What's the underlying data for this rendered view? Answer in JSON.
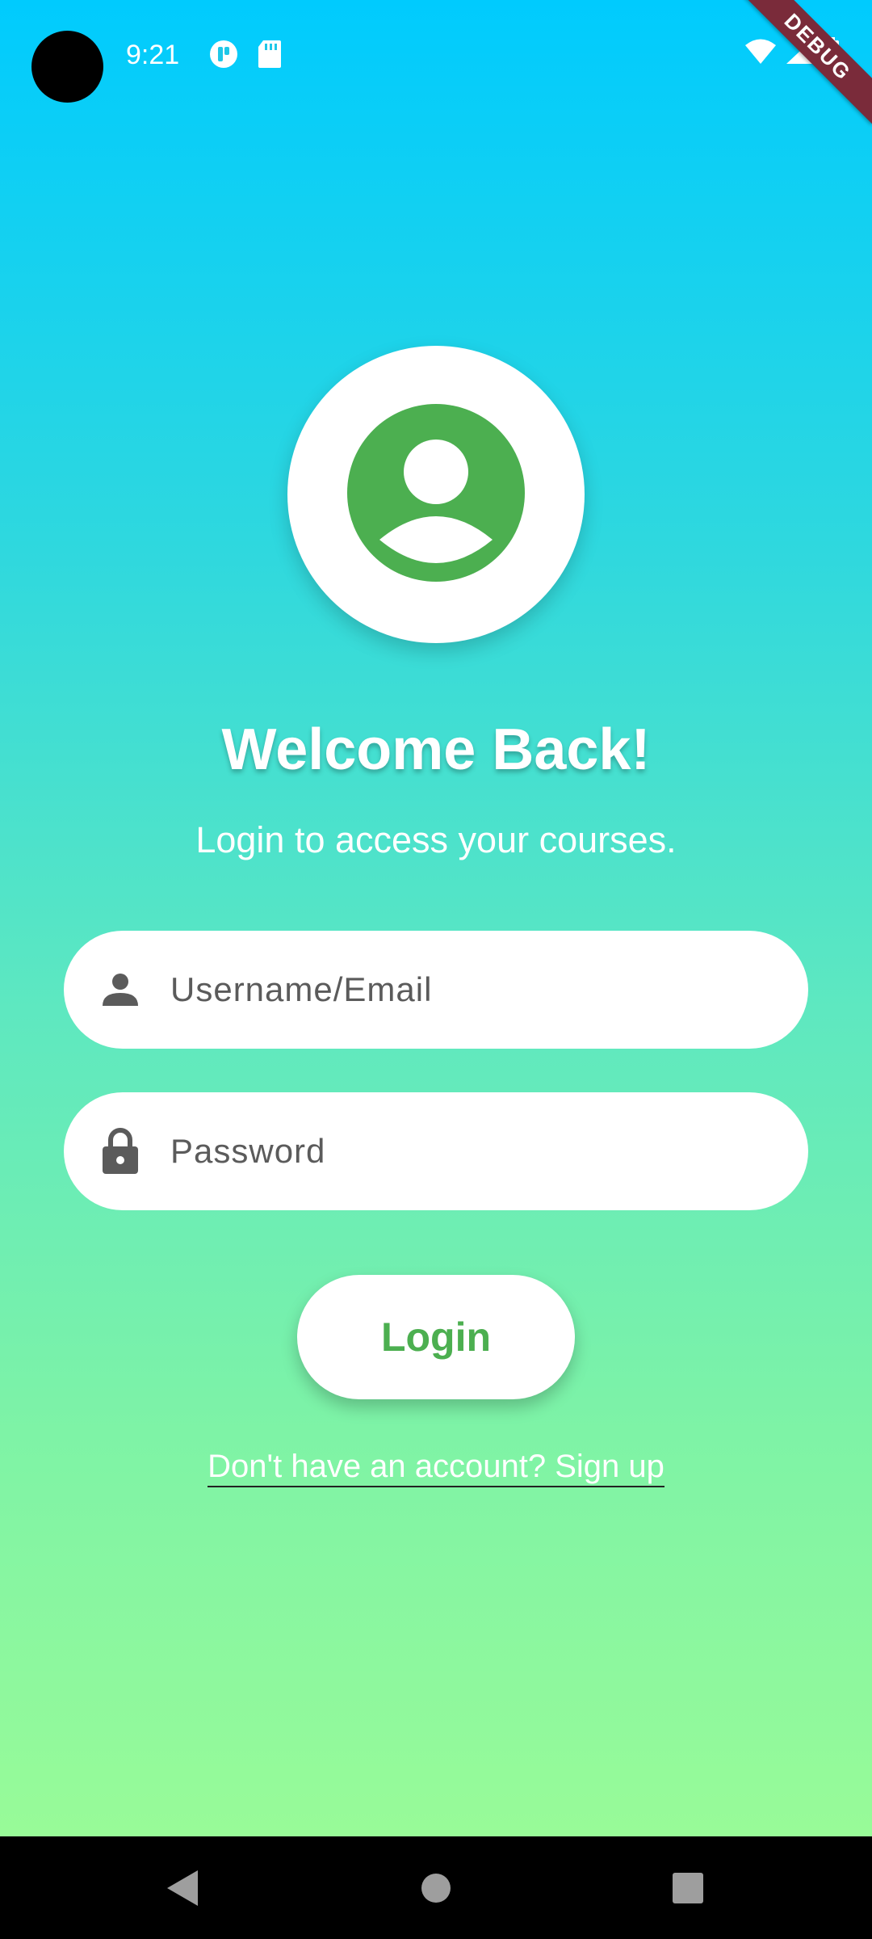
{
  "status_bar": {
    "time": "9:21",
    "left_icons": [
      "flutter-app-icon",
      "sd-card-icon"
    ],
    "right_icons": [
      "wifi-icon",
      "cell-signal-icon",
      "battery-icon"
    ]
  },
  "debug_banner": {
    "label": "DEBUG"
  },
  "login": {
    "avatar_icon": "account-circle-icon",
    "title": "Welcome Back!",
    "subtitle": "Login to access your courses.",
    "username": {
      "placeholder": "Username/Email",
      "value": "",
      "icon": "person-icon"
    },
    "password": {
      "placeholder": "Password",
      "value": "",
      "icon": "lock-icon"
    },
    "login_label": "Login",
    "signup_link": "Don't have an account? Sign up"
  },
  "nav_bar": {
    "buttons": [
      "back-icon",
      "home-icon",
      "recents-icon"
    ]
  },
  "colors": {
    "gradient_top": "#00CBFE",
    "gradient_bottom": "#98FB98",
    "accent_green": "#4CAF50",
    "field_icon": "#5b5b5b"
  }
}
